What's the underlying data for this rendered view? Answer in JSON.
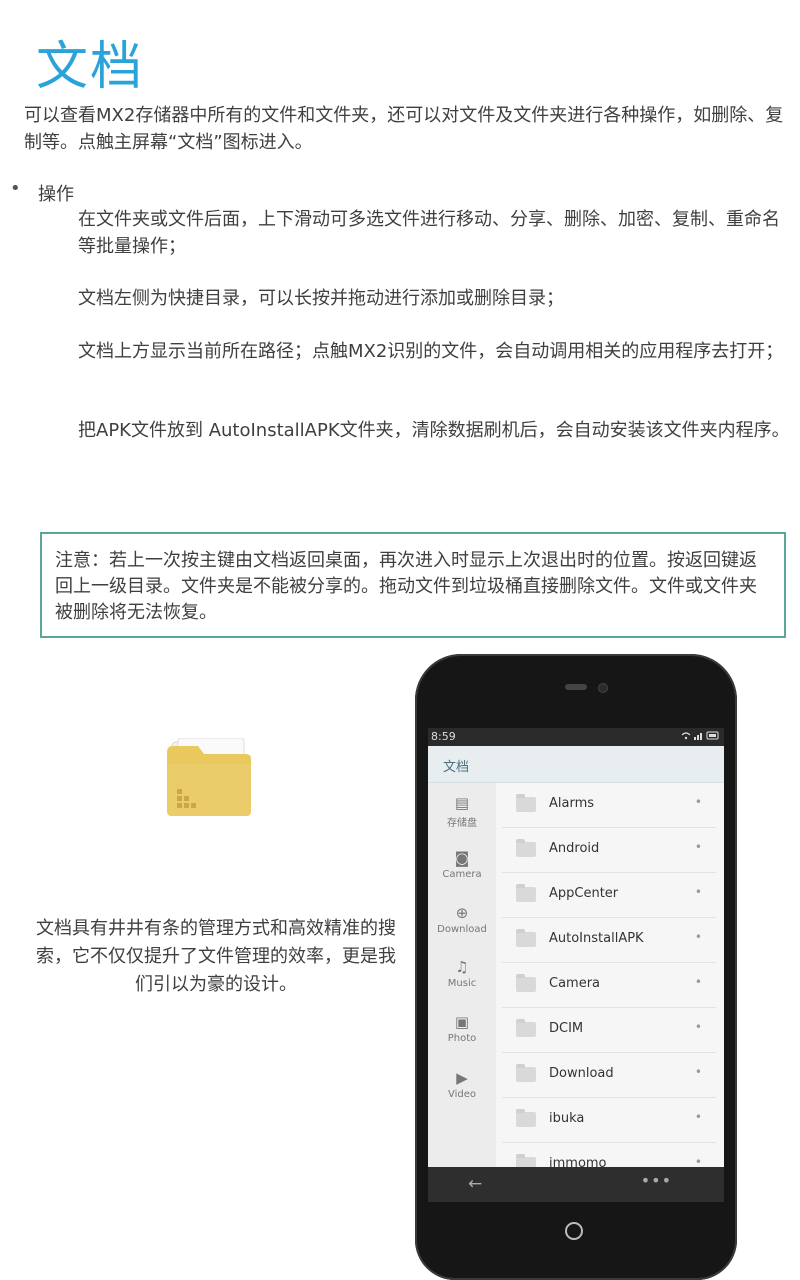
{
  "title": "文档",
  "intro": "可以查看MX2存储器中所有的文件和文件夹，还可以对文件及文件夹进行各种操作，如删除、复制等。点触主屏幕“文档”图标进入。",
  "section": {
    "bullet_label": "操作",
    "paragraphs": [
      "在文件夹或文件后面，上下滑动可多选文件进行移动、分享、删除、加密、复制、重命名等批量操作；",
      "文档左侧为快捷目录，可以长按并拖动进行添加或删除目录；",
      "文档上方显示当前所在路径；点触MX2识别的文件，会自动调用相关的应用程序去打开；",
      "把APK文件放到 AutoInstallAPK文件夹，清除数据刷机后，会自动安装该文件夹内程序。"
    ]
  },
  "notice": "注意：若上一次按主键由文档返回桌面，再次进入时显示上次退出时的位置。按返回键返回上一级目录。文件夹是不能被分享的。拖动文件到垃圾桶直接删除文件。文件或文件夹被删除将无法恢复。",
  "caption": "文档具有井井有条的管理方式和高效精准的搜索，它不仅仅提升了文件管理的效率，更是我们引以为豪的设计。",
  "colors": {
    "title": "#2aa3d8",
    "notice_border": "#5aa79a",
    "folder": "#e9c95e"
  },
  "phone": {
    "status_time": "8:59",
    "status_icons": "wifi-signal-battery-icons",
    "app_title": "文档",
    "sidebar": [
      {
        "label": "存储盘",
        "icon": "sd-card-icon"
      },
      {
        "label": "Camera",
        "icon": "camera-icon"
      },
      {
        "label": "Download",
        "icon": "download-icon"
      },
      {
        "label": "Music",
        "icon": "music-note-icon"
      },
      {
        "label": "Photo",
        "icon": "photo-icon"
      },
      {
        "label": "Video",
        "icon": "video-icon"
      }
    ],
    "files": [
      "Alarms",
      "Android",
      "AppCenter",
      "AutoInstallAPK",
      "Camera",
      "DCIM",
      "Download",
      "ibuka",
      "immomo"
    ],
    "row_marker": "•",
    "nav_back": "←",
    "nav_more": "•••"
  }
}
